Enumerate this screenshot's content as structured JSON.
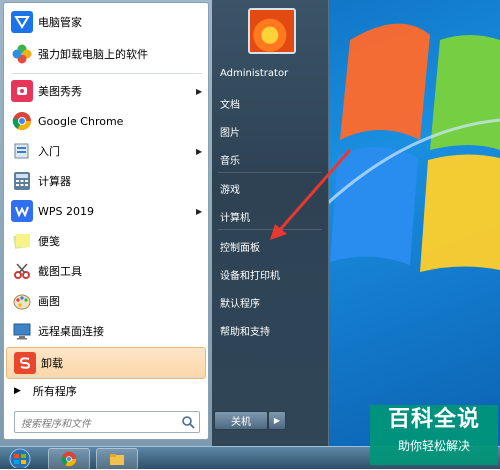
{
  "start_menu": {
    "programs": [
      {
        "label": "电脑管家",
        "icon": "tencent-pc-manager-icon",
        "submenu": false
      },
      {
        "label": "强力卸载电脑上的软件",
        "icon": "uninstall-clover-icon",
        "submenu": false
      },
      {
        "label": "美图秀秀",
        "icon": "meitu-icon",
        "submenu": true
      },
      {
        "label": "Google Chrome",
        "icon": "chrome-icon",
        "submenu": false
      },
      {
        "label": "入门",
        "icon": "getting-started-icon",
        "submenu": true
      },
      {
        "label": "计算器",
        "icon": "calculator-icon",
        "submenu": false
      },
      {
        "label": "WPS 2019",
        "icon": "wps-icon",
        "submenu": true
      },
      {
        "label": "便笺",
        "icon": "sticky-notes-icon",
        "submenu": false
      },
      {
        "label": "截图工具",
        "icon": "snipping-tool-icon",
        "submenu": false
      },
      {
        "label": "画图",
        "icon": "paint-icon",
        "submenu": false
      },
      {
        "label": "远程桌面连接",
        "icon": "remote-desktop-icon",
        "submenu": false
      },
      {
        "label": "卸载",
        "icon": "uninstall-s-icon",
        "submenu": false,
        "highlighted": true
      }
    ],
    "all_programs_label": "所有程序",
    "search_placeholder": "搜索程序和文件",
    "right_links": {
      "user": "Administrator",
      "documents": "文档",
      "pictures": "图片",
      "music": "音乐",
      "games": "游戏",
      "computer": "计算机",
      "control_panel": "控制面板",
      "devices_printers": "设备和打印机",
      "default_programs": "默认程序",
      "help_support": "帮助和支持"
    },
    "shutdown_label": "关机"
  },
  "watermark": {
    "title": "百科全说",
    "subtitle": "助你轻松解决"
  },
  "colors": {
    "annotation_arrow": "#e8382f",
    "watermark_bg": "#009678",
    "highlight": "#fcd7a8"
  }
}
